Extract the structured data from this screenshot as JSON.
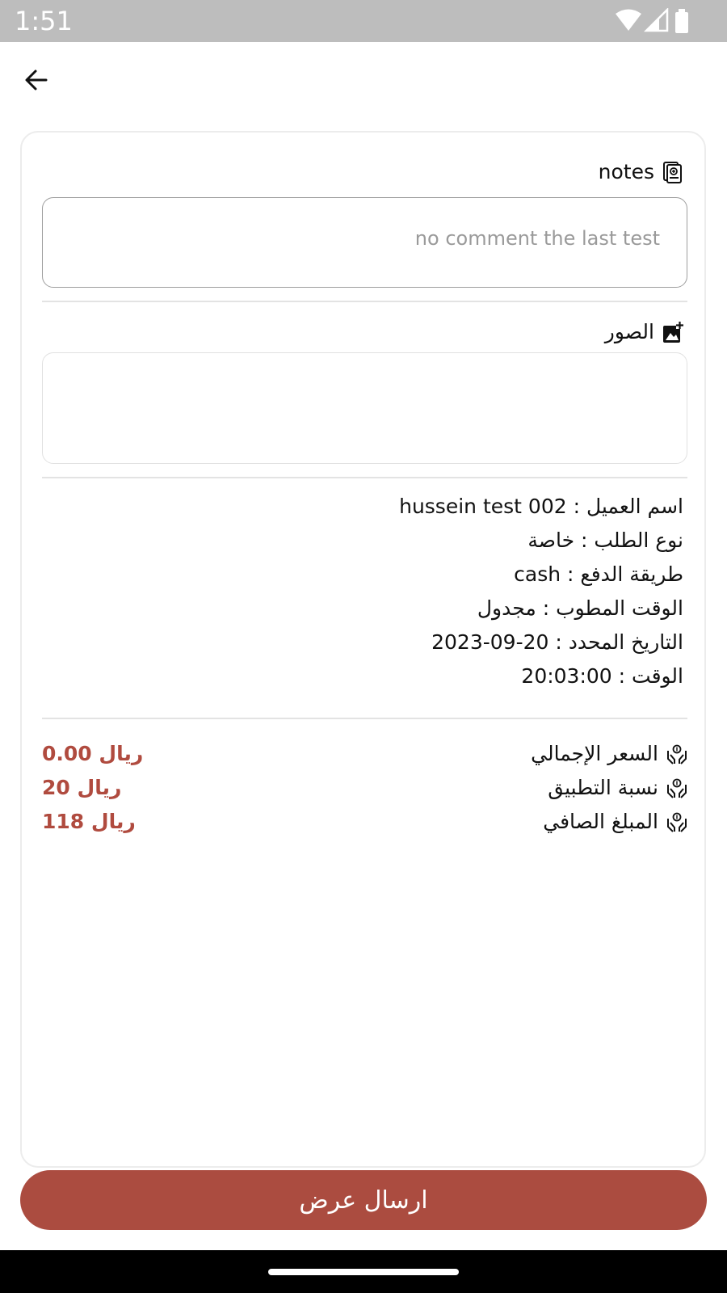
{
  "status_bar": {
    "time": "1:51",
    "icons": [
      "wifi-icon",
      "signal-icon",
      "battery-icon"
    ]
  },
  "app_bar": {
    "back_icon": "arrow-left-icon"
  },
  "notes": {
    "label": "notes",
    "icon": "notes-icon",
    "value": "no comment the last test"
  },
  "images": {
    "label": "الصور",
    "icon": "add-photo-icon"
  },
  "details": {
    "customer_name": "اسم العميل : hussein test 002",
    "request_type": "نوع الطلب : خاصة",
    "payment_method": "طريقة الدفع : cash",
    "requested_time": "الوقت المطوب : مجدول",
    "scheduled_date": "التاريخ المحدد : 20-09-2023",
    "time": "الوقت : 20:03:00"
  },
  "pricing": [
    {
      "label": "السعر الإجمالي",
      "value": "0.00 ريال",
      "icon": "hands-money-icon"
    },
    {
      "label": "نسبة التطبيق",
      "value": "20 ريال",
      "icon": "hands-money-icon"
    },
    {
      "label": "المبلغ الصافي",
      "value": "118 ريال",
      "icon": "hands-money-icon"
    }
  ],
  "submit_button": {
    "label": "ارسال عرض"
  },
  "colors": {
    "accent": "#ab4c40",
    "price_text": "#b04b3f",
    "status_bar": "#bdbdbd"
  }
}
